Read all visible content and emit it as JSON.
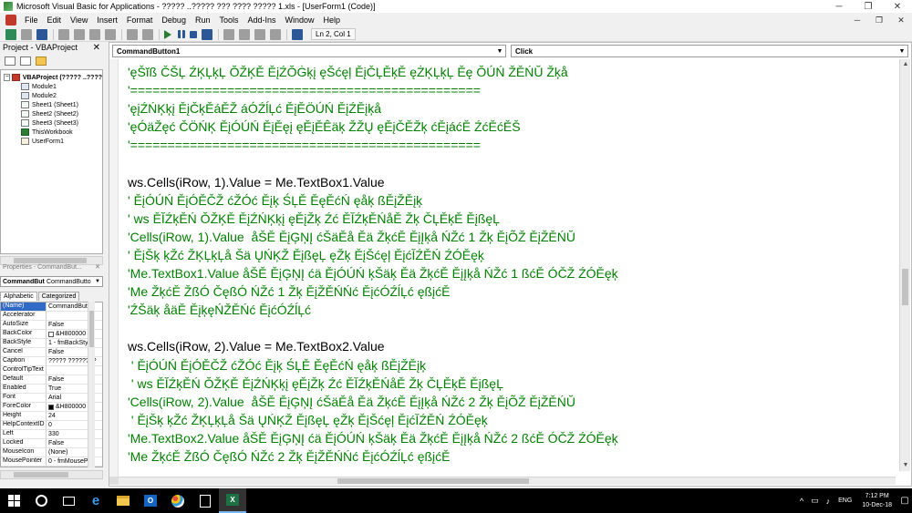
{
  "window": {
    "title": "Microsoft Visual Basic for Applications - ????? ..????? ??? ???? ????? 1.xls - [UserForm1 (Code)]",
    "minimize": "─",
    "restore": "❐",
    "close": "✕"
  },
  "menu": {
    "items": [
      "File",
      "Edit",
      "View",
      "Insert",
      "Format",
      "Debug",
      "Run",
      "Tools",
      "Add-Ins",
      "Window",
      "Help"
    ],
    "inner_min": "─",
    "inner_restore": "❐",
    "inner_close": "✕"
  },
  "toolbar": {
    "position": "Ln 2, Col 1"
  },
  "project": {
    "title": "Project - VBAProject",
    "close": "✕",
    "tree": [
      {
        "label": "VBAProject (????? ..????",
        "level": 0,
        "icon": "proj",
        "expander": "−",
        "bold": true
      },
      {
        "label": "Module1",
        "level": 1,
        "icon": "mod"
      },
      {
        "label": "Module2",
        "level": 1,
        "icon": "mod"
      },
      {
        "label": "Sheet1 (Sheet1)",
        "level": 1,
        "icon": "sheet"
      },
      {
        "label": "Sheet2 (Sheet2)",
        "level": 1,
        "icon": "sheet"
      },
      {
        "label": "Sheet3 (Sheet3)",
        "level": 1,
        "icon": "sheet"
      },
      {
        "label": "ThisWorkbook",
        "level": 1,
        "icon": "wb"
      },
      {
        "label": "UserForm1",
        "level": 1,
        "icon": "form"
      }
    ]
  },
  "properties": {
    "title": "Properties - CommandBut...",
    "close": "✕",
    "object_name": "CommandBut",
    "object_type": "CommandButto",
    "tabs": [
      "Alphabetic",
      "Categorized"
    ],
    "rows": [
      {
        "name": "(Name)",
        "value": "CommandButto",
        "selected": true
      },
      {
        "name": "Accelerator",
        "value": ""
      },
      {
        "name": "AutoSize",
        "value": "False"
      },
      {
        "name": "BackColor",
        "value": "&H800000",
        "swatch": "#ffffff"
      },
      {
        "name": "BackStyle",
        "value": "1 - fmBackStyl"
      },
      {
        "name": "Cancel",
        "value": "False"
      },
      {
        "name": "Caption",
        "value": "????? ????????"
      },
      {
        "name": "ControlTipText",
        "value": ""
      },
      {
        "name": "Default",
        "value": "False"
      },
      {
        "name": "Enabled",
        "value": "True"
      },
      {
        "name": "Font",
        "value": "Arial"
      },
      {
        "name": "ForeColor",
        "value": "&H800000",
        "swatch": "#000000"
      },
      {
        "name": "Height",
        "value": "24"
      },
      {
        "name": "HelpContextID",
        "value": "0"
      },
      {
        "name": "Left",
        "value": "330"
      },
      {
        "name": "Locked",
        "value": "False"
      },
      {
        "name": "MouseIcon",
        "value": "(None)"
      },
      {
        "name": "MousePointer",
        "value": "0 - fmMousePo"
      }
    ]
  },
  "code": {
    "object_combo": "CommandButton1",
    "procedure_combo": "Click",
    "lines": [
      {
        "text": "'ęŠĭß ČŠĻ ŹĶĻķĻ ŎŽĶĚ ĚįŹŎĠķį ęŠćęļ ĚįČĻĚķĚ ęŻĶĻķĻ Ěę ŎÚŃ ŽĚŃŬ Žķå",
        "kind": "comment"
      },
      {
        "text": "'===============================================",
        "kind": "comment"
      },
      {
        "text": "'ęįŹŃĶķį ĚįČķĚáĚŽ áÓŹĺĻć ĚįĚÖÚŃ ĚįŹĚįķå",
        "kind": "comment"
      },
      {
        "text": "'ęÓäŽęć ČÖŃĶ ĚįÓÚŃ ĚįĚęį ęĚįĚÊäķ ŽŽŲ ęĚįČĚŽķ ćĚįáćĚ ŹćĚćĚŠ",
        "kind": "comment"
      },
      {
        "text": "'===============================================",
        "kind": "comment"
      },
      {
        "text": "",
        "kind": "code"
      },
      {
        "text": "ws.Cells(iRow, 1).Value = Me.TextBox1.Value",
        "kind": "code"
      },
      {
        "text": "' ĚįÓÚŃ ĚįÓĚČŽ ćŽÓć Ěįķ ŚĻĚ ĚęĚćŃ ęåķ ßĚįŽĚįķ",
        "kind": "comment"
      },
      {
        "text": "' ws ĚĬŹķĚŃ ŎŽĶĚ ĚįŹŃĶķį ęĚįŽķ Źć ĚĬŹķĚŃåĚ Žķ ČĻĚķĚ ĚįßęĻ",
        "kind": "comment"
      },
      {
        "text": "'Cells(iRow, 1).Value  åŠĚ ĚįĢŅĮ ćŠäĚå Ěä ŽķćĚ ĚįĮķå ŃŽć 1 Žķ ĚįÕŽ ĚįŽĚŃŬ",
        "kind": "comment"
      },
      {
        "text": "' ĚįŠķ ķŽć ŽĶĻķĻå Šä ŲŃĶŽ ĚįßęĻ ęŽķ ĚįŠćęļ ĚįćĬŹĚŃ ŹÓĚęķ",
        "kind": "comment"
      },
      {
        "text": "'Me.TextBox1.Value åŠĚ ĚįĢŅĮ ćä ĚįÓÚŃ ķŠäķ Ěä ŽķćĚ ĚįĮķå ŃŽć 1 ßćĚ ÓČŽ ŹÓĚęķ",
        "kind": "comment"
      },
      {
        "text": "'Me ŽķćĚ ŽßÓ ČęßÓ ŃŽć 1 Žķ ĚįŽĚŃŃć ĚįćÓŹĺĻć ęßįćĚ",
        "kind": "comment"
      },
      {
        "text": "'ŹŠäķ åäĚ ĚįķęŃŽĚŃć ĚįćÓŹĺĻć",
        "kind": "comment"
      },
      {
        "text": "",
        "kind": "code"
      },
      {
        "text": "ws.Cells(iRow, 2).Value = Me.TextBox2.Value",
        "kind": "code"
      },
      {
        "text": " ' ĚįÓÚŃ ĚįÓĚČŽ ćŽÓć Ěįķ ŚĻĚ ĚęĚćŃ ęåķ ßĚįŽĚįķ",
        "kind": "comment"
      },
      {
        "text": " ' ws ĚĬŹķĚŃ ŎŽĶĚ ĚįŹŃĶķį ęĚįŽķ Źć ĚĬŹķĚŃåĚ Žķ ČĻĚķĚ ĚįßęĻ",
        "kind": "comment"
      },
      {
        "text": "'Cells(iRow, 2).Value  åŠĚ ĚįĢŅĮ ćŠäĚå Ěä ŽķćĚ ĚįĮķå ŃŽć 2 Žķ ĚįÕŽ ĚįŽĚŃŬ",
        "kind": "comment"
      },
      {
        "text": " ' ĚįŠķ ķŽć ŽĶĻķĻå Šä ŲŃĶŽ ĚįßęĻ ęŽķ ĚįŠćęļ ĚįćĬŹĚŃ ŹÓĚęķ",
        "kind": "comment"
      },
      {
        "text": "'Me.TextBox2.Value åŠĚ ĚįĢŅĮ ćä ĚįÓÚŃ ķŠäķ Ěä ŽķćĚ ĚįĮķå ŃŽć 2 ßćĚ ÓČŽ ŹÓĚęķ",
        "kind": "comment"
      },
      {
        "text": "'Me ŽķćĚ ŽßÓ ČęßÓ ŃŽć 2 Žķ ĚįŽĚŃŃć ĚįćÓŹĺĻć ęßįćĚ",
        "kind": "comment"
      }
    ]
  },
  "taskbar": {
    "search_glyph": "",
    "outlook_letter": "O",
    "excel_letter": "X",
    "tray_up": "^",
    "tray_network": "▭",
    "tray_volume": "♪",
    "language": "ENG",
    "time": "7:12 PM",
    "date": "10-Dec-18",
    "notifications": "▢"
  }
}
